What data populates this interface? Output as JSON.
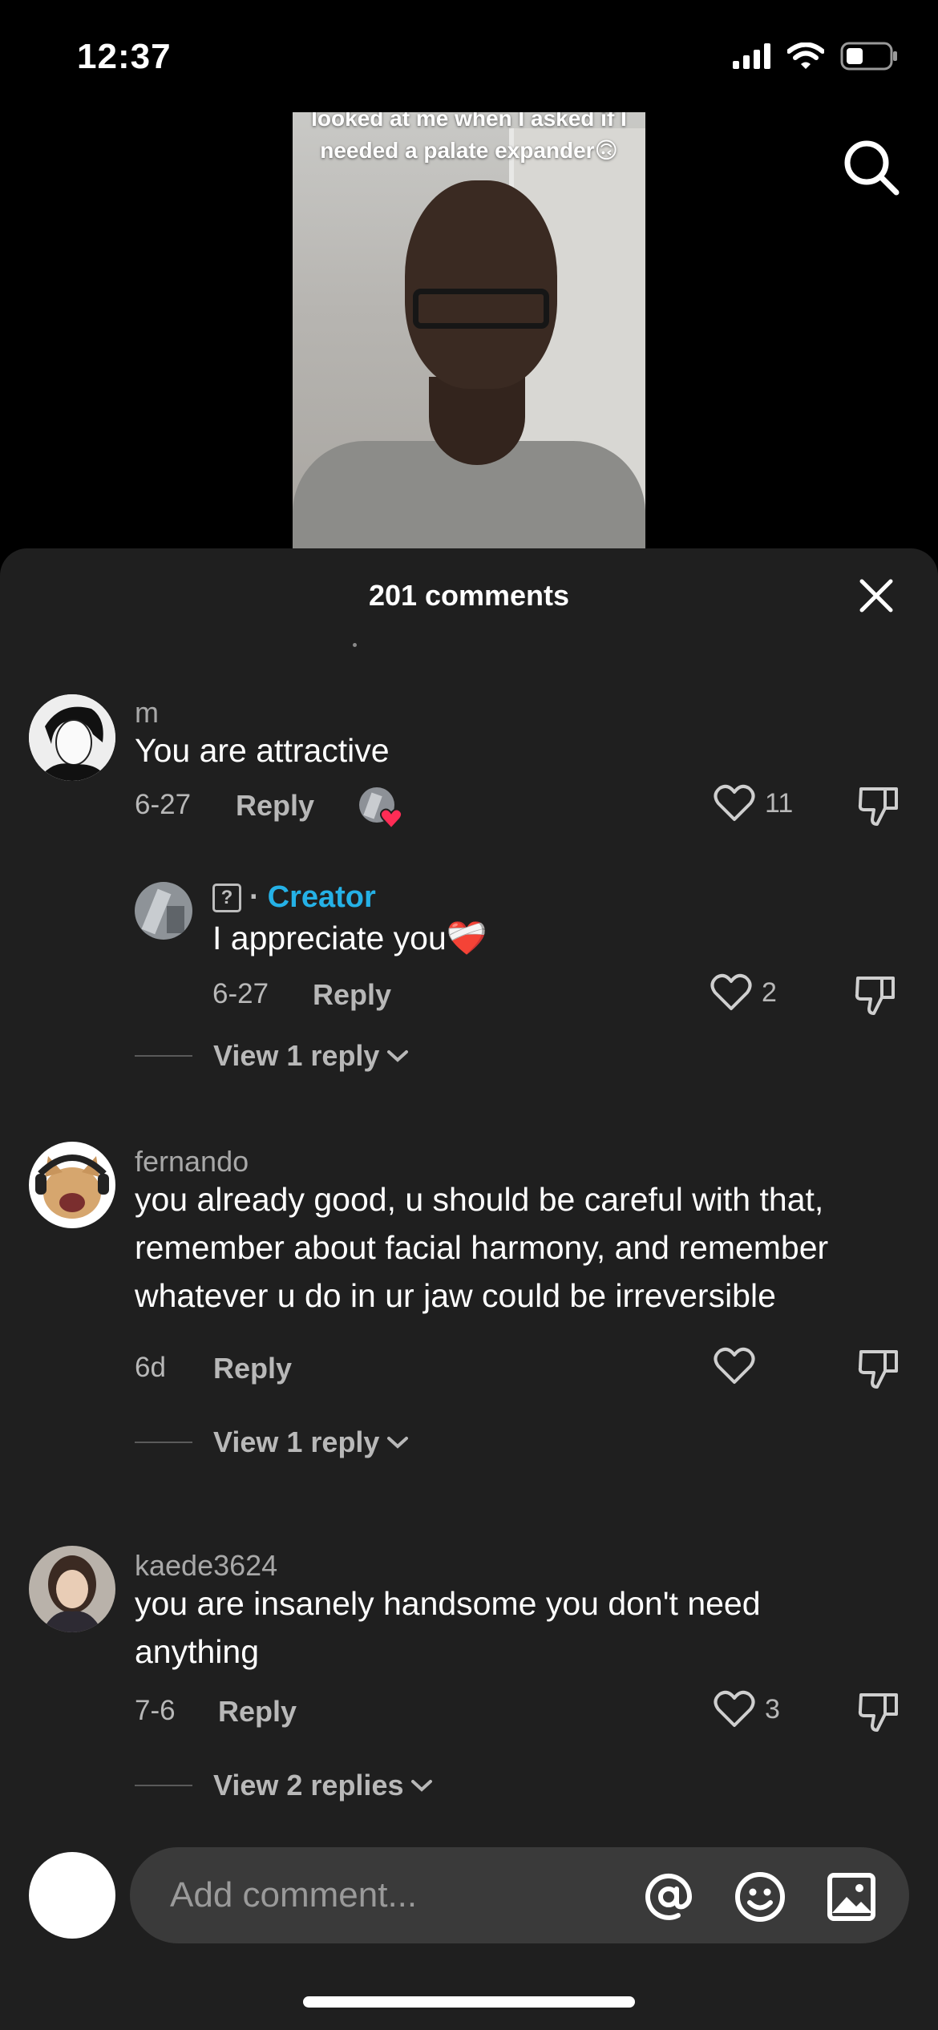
{
  "status_bar": {
    "time": "12:37"
  },
  "video": {
    "caption": "looked at me when I asked if I needed a palate expander🙃"
  },
  "sheet": {
    "title": "201 comments",
    "icons": {
      "search": "search-icon",
      "close": "close-icon"
    }
  },
  "comments": [
    {
      "username": "m",
      "text": "You are attractive",
      "date": "6-27",
      "reply_label": "Reply",
      "likes": "11",
      "creator_liked": true,
      "reply": {
        "badge": "?",
        "separator": "·",
        "creator_label": "Creator",
        "text": "I appreciate you❤️‍🩹",
        "date": "6-27",
        "reply_label": "Reply",
        "likes": "2"
      },
      "view_replies": "View 1 reply"
    },
    {
      "username": "fernando",
      "text": "you already good, u should be careful with that, remember about facial harmony, and remember whatever u do in ur jaw could be irreversible",
      "date": "6d",
      "reply_label": "Reply",
      "likes": "",
      "view_replies": "View 1 reply"
    },
    {
      "username": "kaede3624",
      "text": "you are insanely handsome you don't need anything",
      "date": "7-6",
      "reply_label": "Reply",
      "likes": "3",
      "view_replies": "View 2 replies"
    }
  ],
  "input": {
    "placeholder": "Add comment...",
    "icons": [
      "mention-icon",
      "emoji-icon",
      "image-icon"
    ]
  }
}
